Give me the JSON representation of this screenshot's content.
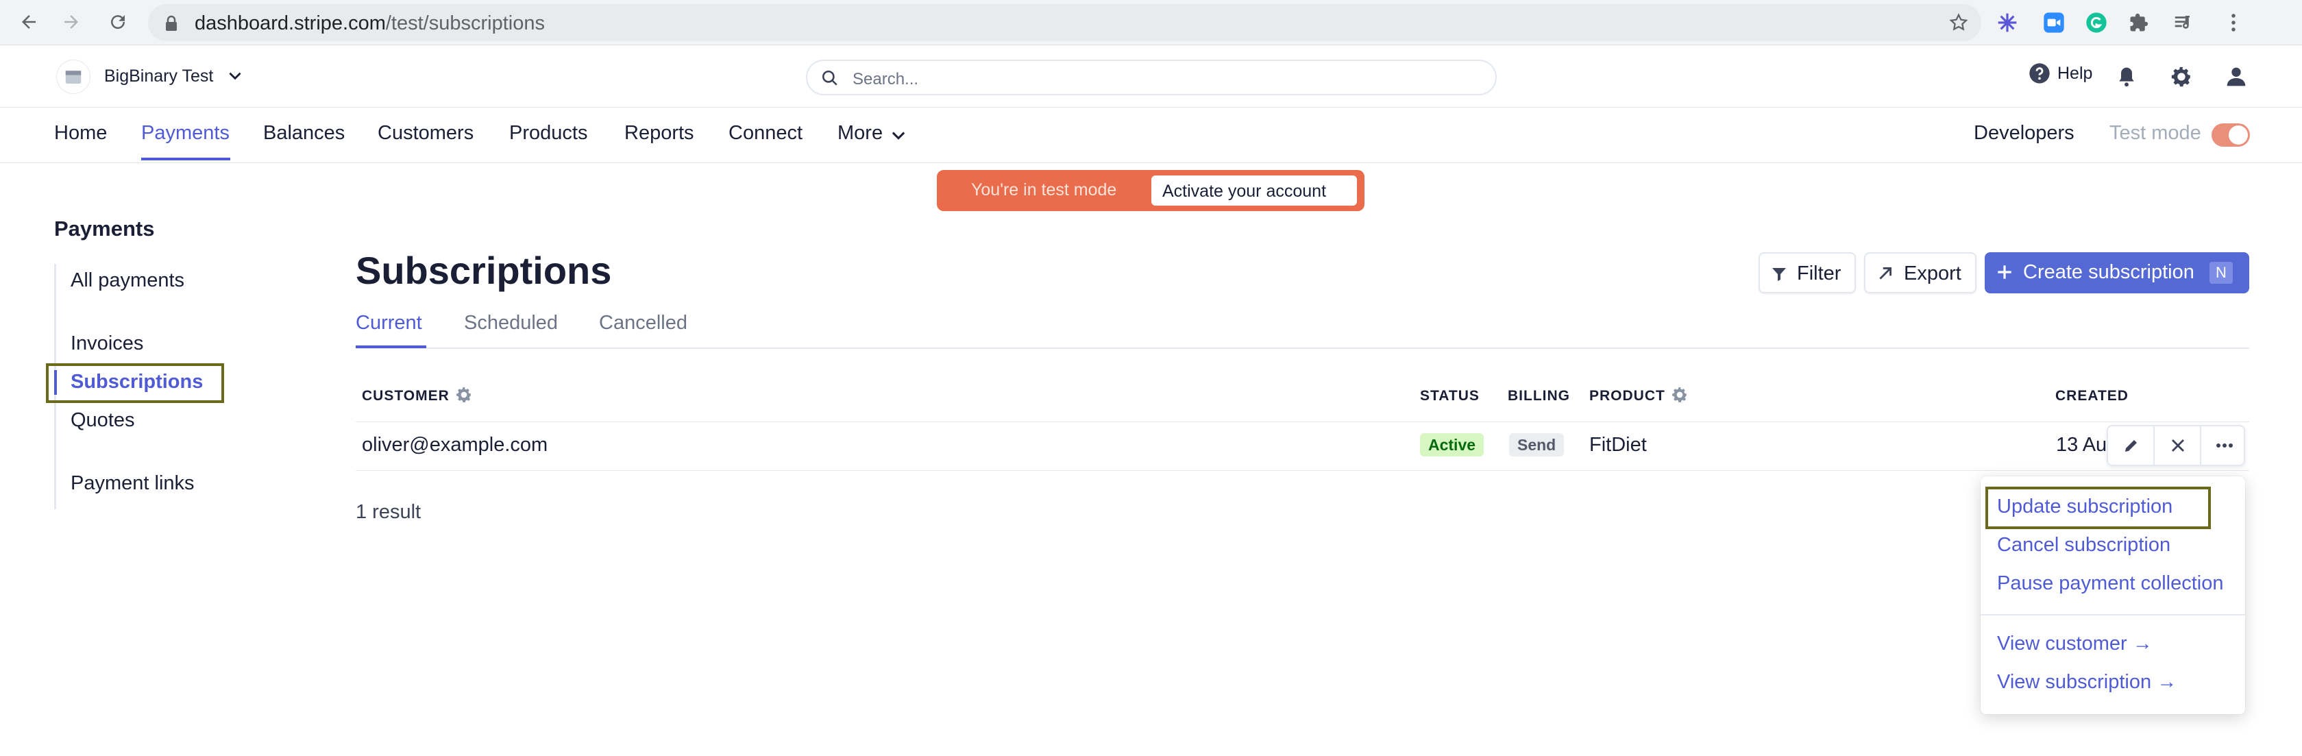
{
  "browser": {
    "url_host": "dashboard.stripe.com",
    "url_path": "/test/subscriptions"
  },
  "header": {
    "account_name": "BigBinary Test",
    "search_placeholder": "Search...",
    "help_label": "Help"
  },
  "primary_nav": {
    "items": [
      "Home",
      "Payments",
      "Balances",
      "Customers",
      "Products",
      "Reports",
      "Connect",
      "More"
    ],
    "active": "Payments",
    "developers_label": "Developers",
    "test_mode_label": "Test mode",
    "test_mode_on": true
  },
  "banner": {
    "text": "You're in test mode",
    "button_label": "Activate your account"
  },
  "sidebar": {
    "title": "Payments",
    "items": [
      "All payments",
      "Invoices",
      "Subscriptions",
      "Quotes",
      "Payment links"
    ],
    "active": "Subscriptions"
  },
  "main": {
    "title": "Subscriptions",
    "filter_label": "Filter",
    "export_label": "Export",
    "create_label": "Create subscription",
    "create_shortcut": "N",
    "tabs": [
      "Current",
      "Scheduled",
      "Cancelled"
    ],
    "active_tab": "Current",
    "columns": {
      "customer": "CUSTOMER",
      "status": "STATUS",
      "billing": "BILLING",
      "product": "PRODUCT",
      "created": "CREATED"
    },
    "rows": [
      {
        "customer": "oliver@example.com",
        "status": "Active",
        "billing": "Send",
        "product": "FitDiet",
        "created": "13 Aug"
      }
    ],
    "result_count": "1 result"
  },
  "action_menu": {
    "items": [
      "Update subscription",
      "Cancel subscription",
      "Pause payment collection"
    ],
    "links": [
      "View customer →",
      "View subscription →"
    ]
  },
  "colors": {
    "accent": "#4f5bd5",
    "primary_button": "#5469d4",
    "banner": "#e96d4c",
    "highlight_box": "#6b6a1c"
  }
}
